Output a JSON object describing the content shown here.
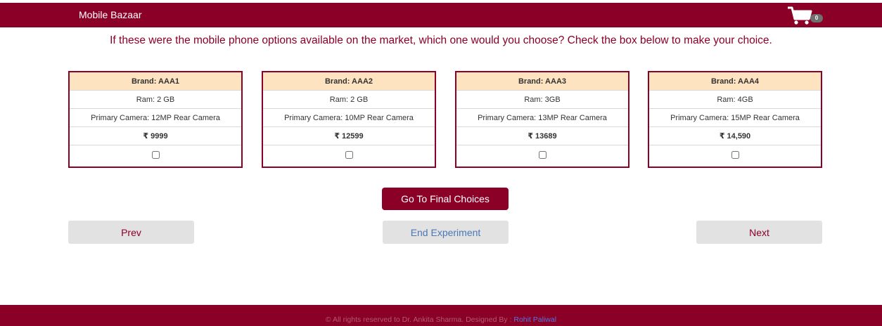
{
  "header": {
    "brand": "Mobile Bazaar",
    "cart_icon": "shopping-cart-icon",
    "cart_count": "0"
  },
  "question": "If these were the mobile phone options available on the market, which one would you choose? Check the box below to make your choice.",
  "products": [
    {
      "brand": "Brand: AAA1",
      "ram": "Ram: 2 GB",
      "camera": "Primary Camera: 12MP Rear Camera",
      "price": "₹ 9999"
    },
    {
      "brand": "Brand: AAA2",
      "ram": "Ram: 2 GB",
      "camera": "Primary Camera: 10MP Rear Camera",
      "price": "₹ 12599"
    },
    {
      "brand": "Brand: AAA3",
      "ram": "Ram: 3GB",
      "camera": "Primary Camera: 13MP Rear Camera",
      "price": "₹ 13689"
    },
    {
      "brand": "Brand: AAA4",
      "ram": "Ram: 4GB",
      "camera": "Primary Camera: 15MP Rear Camera",
      "price": "₹ 14,590"
    }
  ],
  "actions": {
    "final_choices": "Go To Final Choices",
    "prev": "Prev",
    "end_experiment": "End Experiment",
    "next": "Next"
  },
  "footer": {
    "text": "© All rights reserved to Dr. Ankita Sharma. Designed By : ",
    "designer": "Rohit Paliwal"
  },
  "colors": {
    "primary": "#8b0027",
    "header_cell": "#fde3c0",
    "button_gray": "#e2e2e2",
    "link_blue": "#4a78b5"
  }
}
